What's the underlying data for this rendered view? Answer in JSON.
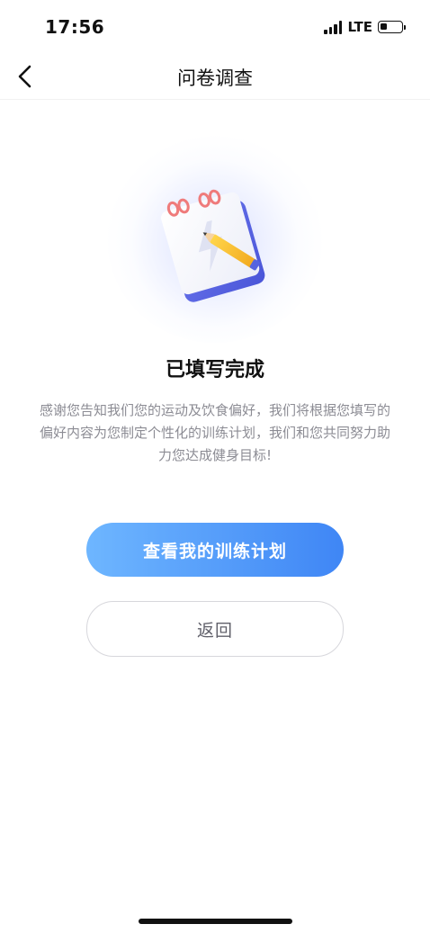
{
  "status_bar": {
    "time": "17:56",
    "network": "LTE",
    "battery_level": 0.35
  },
  "nav": {
    "back_icon": "chevron-left-icon",
    "title": "问卷调查"
  },
  "illustration": {
    "icon": "notebook-pencil-icon"
  },
  "result": {
    "title": "已填写完成",
    "description": "感谢您告知我们您的运动及饮食偏好，我们将根据您填写的偏好内容为您制定个性化的训练计划，我们和您共同努力助力您达成健身目标!"
  },
  "actions": {
    "view_plan_label": "查看我的训练计划",
    "back_label": "返回"
  },
  "colors": {
    "primary_gradient_start": "#6eb6ff",
    "primary_gradient_end": "#3f86f5",
    "description_text": "#8c8c94",
    "secondary_border": "#d7d7dc"
  }
}
